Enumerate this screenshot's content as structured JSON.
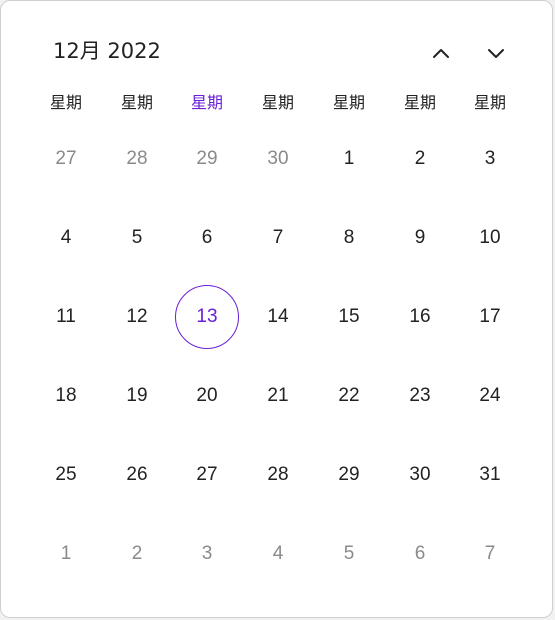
{
  "header": {
    "title": "12月 2022"
  },
  "weekdays": [
    "星期",
    "星期",
    "星期",
    "星期",
    "星期",
    "星期",
    "星期"
  ],
  "weeks": [
    [
      {
        "label": "27",
        "muted": true
      },
      {
        "label": "28",
        "muted": true
      },
      {
        "label": "29",
        "muted": true
      },
      {
        "label": "30",
        "muted": true
      },
      {
        "label": "1"
      },
      {
        "label": "2"
      },
      {
        "label": "3"
      }
    ],
    [
      {
        "label": "4"
      },
      {
        "label": "5"
      },
      {
        "label": "6"
      },
      {
        "label": "7"
      },
      {
        "label": "8"
      },
      {
        "label": "9"
      },
      {
        "label": "10"
      }
    ],
    [
      {
        "label": "11"
      },
      {
        "label": "12"
      },
      {
        "label": "13",
        "today": true
      },
      {
        "label": "14"
      },
      {
        "label": "15"
      },
      {
        "label": "16"
      },
      {
        "label": "17"
      }
    ],
    [
      {
        "label": "18"
      },
      {
        "label": "19"
      },
      {
        "label": "20"
      },
      {
        "label": "21"
      },
      {
        "label": "22"
      },
      {
        "label": "23"
      },
      {
        "label": "24"
      }
    ],
    [
      {
        "label": "25"
      },
      {
        "label": "26"
      },
      {
        "label": "27"
      },
      {
        "label": "28"
      },
      {
        "label": "29"
      },
      {
        "label": "30"
      },
      {
        "label": "31"
      }
    ],
    [
      {
        "label": "1",
        "muted": true
      },
      {
        "label": "2",
        "muted": true
      },
      {
        "label": "3",
        "muted": true
      },
      {
        "label": "4",
        "muted": true
      },
      {
        "label": "5",
        "muted": true
      },
      {
        "label": "6",
        "muted": true
      },
      {
        "label": "7",
        "muted": true
      }
    ]
  ],
  "today_column": 2,
  "icons": {
    "prev": "chevron-up-icon",
    "next": "chevron-down-icon"
  },
  "colors": {
    "accent": "#6a1fd6",
    "text": "#222222",
    "muted": "#8a8a8a",
    "border": "#cfcfcf"
  }
}
